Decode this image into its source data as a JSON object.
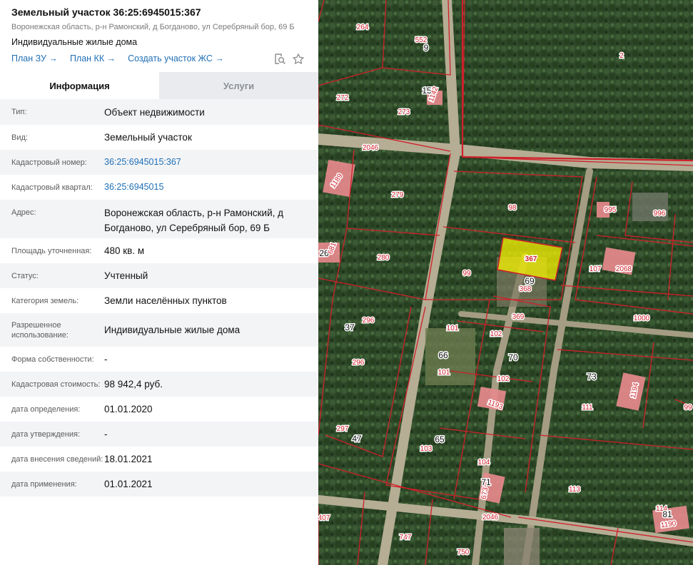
{
  "header": {
    "title": "Земельный участок 36:25:6945015:367",
    "address_line": "Воронежская область, р-н Рамонский, д Богданово, ул Серебряный бор, 69 Б",
    "purpose": "Индивидуальные жилые дома",
    "links": [
      "План ЗУ →",
      "План КК →",
      "Создать участок ЖС →"
    ]
  },
  "tabs": [
    "Информация",
    "Услуги"
  ],
  "rows": [
    {
      "label": "Тип:",
      "value": "Объект недвижимости"
    },
    {
      "label": "Вид:",
      "value": "Земельный участок"
    },
    {
      "label": "Кадастровый номер:",
      "value": "36:25:6945015:367"
    },
    {
      "label": "Кадастровый квартал:",
      "value": "36:25:6945015"
    },
    {
      "label": "Адрес:",
      "value": "Воронежская область, р-н Рамонский, д Богданово, ул Серебряный бор, 69 Б"
    },
    {
      "label": "Площадь уточненная:",
      "value": "480 кв. м"
    },
    {
      "label": "Статус:",
      "value": "Учтенный"
    },
    {
      "label": "Категория земель:",
      "value": "Земли населённых пунктов"
    },
    {
      "label": "Разрешенное использование:",
      "value": "Индивидуальные жилые дома"
    },
    {
      "label": "Форма собственности:",
      "value": "-"
    },
    {
      "label": "Кадастровая стоимость:",
      "value": "98 942,4 руб."
    },
    {
      "label": "дата определения:",
      "value": "01.01.2020"
    },
    {
      "label": "дата утверждения:",
      "value": "-"
    },
    {
      "label": "дата внесения сведений:",
      "value": "18.01.2021"
    },
    {
      "label": "дата применения:",
      "value": "01.01.2021"
    }
  ],
  "map": {
    "labels": [
      "264",
      "552",
      "9",
      "2",
      "272",
      "15",
      "1142",
      "273",
      "2046",
      "1189",
      "279",
      "98",
      "995",
      "996",
      "26",
      "681",
      "280",
      "367",
      "107",
      "2068",
      "99",
      "69",
      "368",
      "369",
      "37",
      "296",
      "101",
      "102",
      "1000",
      "66",
      "70",
      "296",
      "101",
      "73",
      "1194",
      "102",
      "1193",
      "111",
      "99",
      "297",
      "47",
      "65",
      "103",
      "104",
      "113",
      "71",
      "673",
      "2046",
      "114",
      "81",
      "1190",
      "407",
      "747",
      "750"
    ],
    "colors": {
      "boundary": "#d0202a",
      "selected": "#f7f300",
      "building": "#e88a8d"
    }
  }
}
